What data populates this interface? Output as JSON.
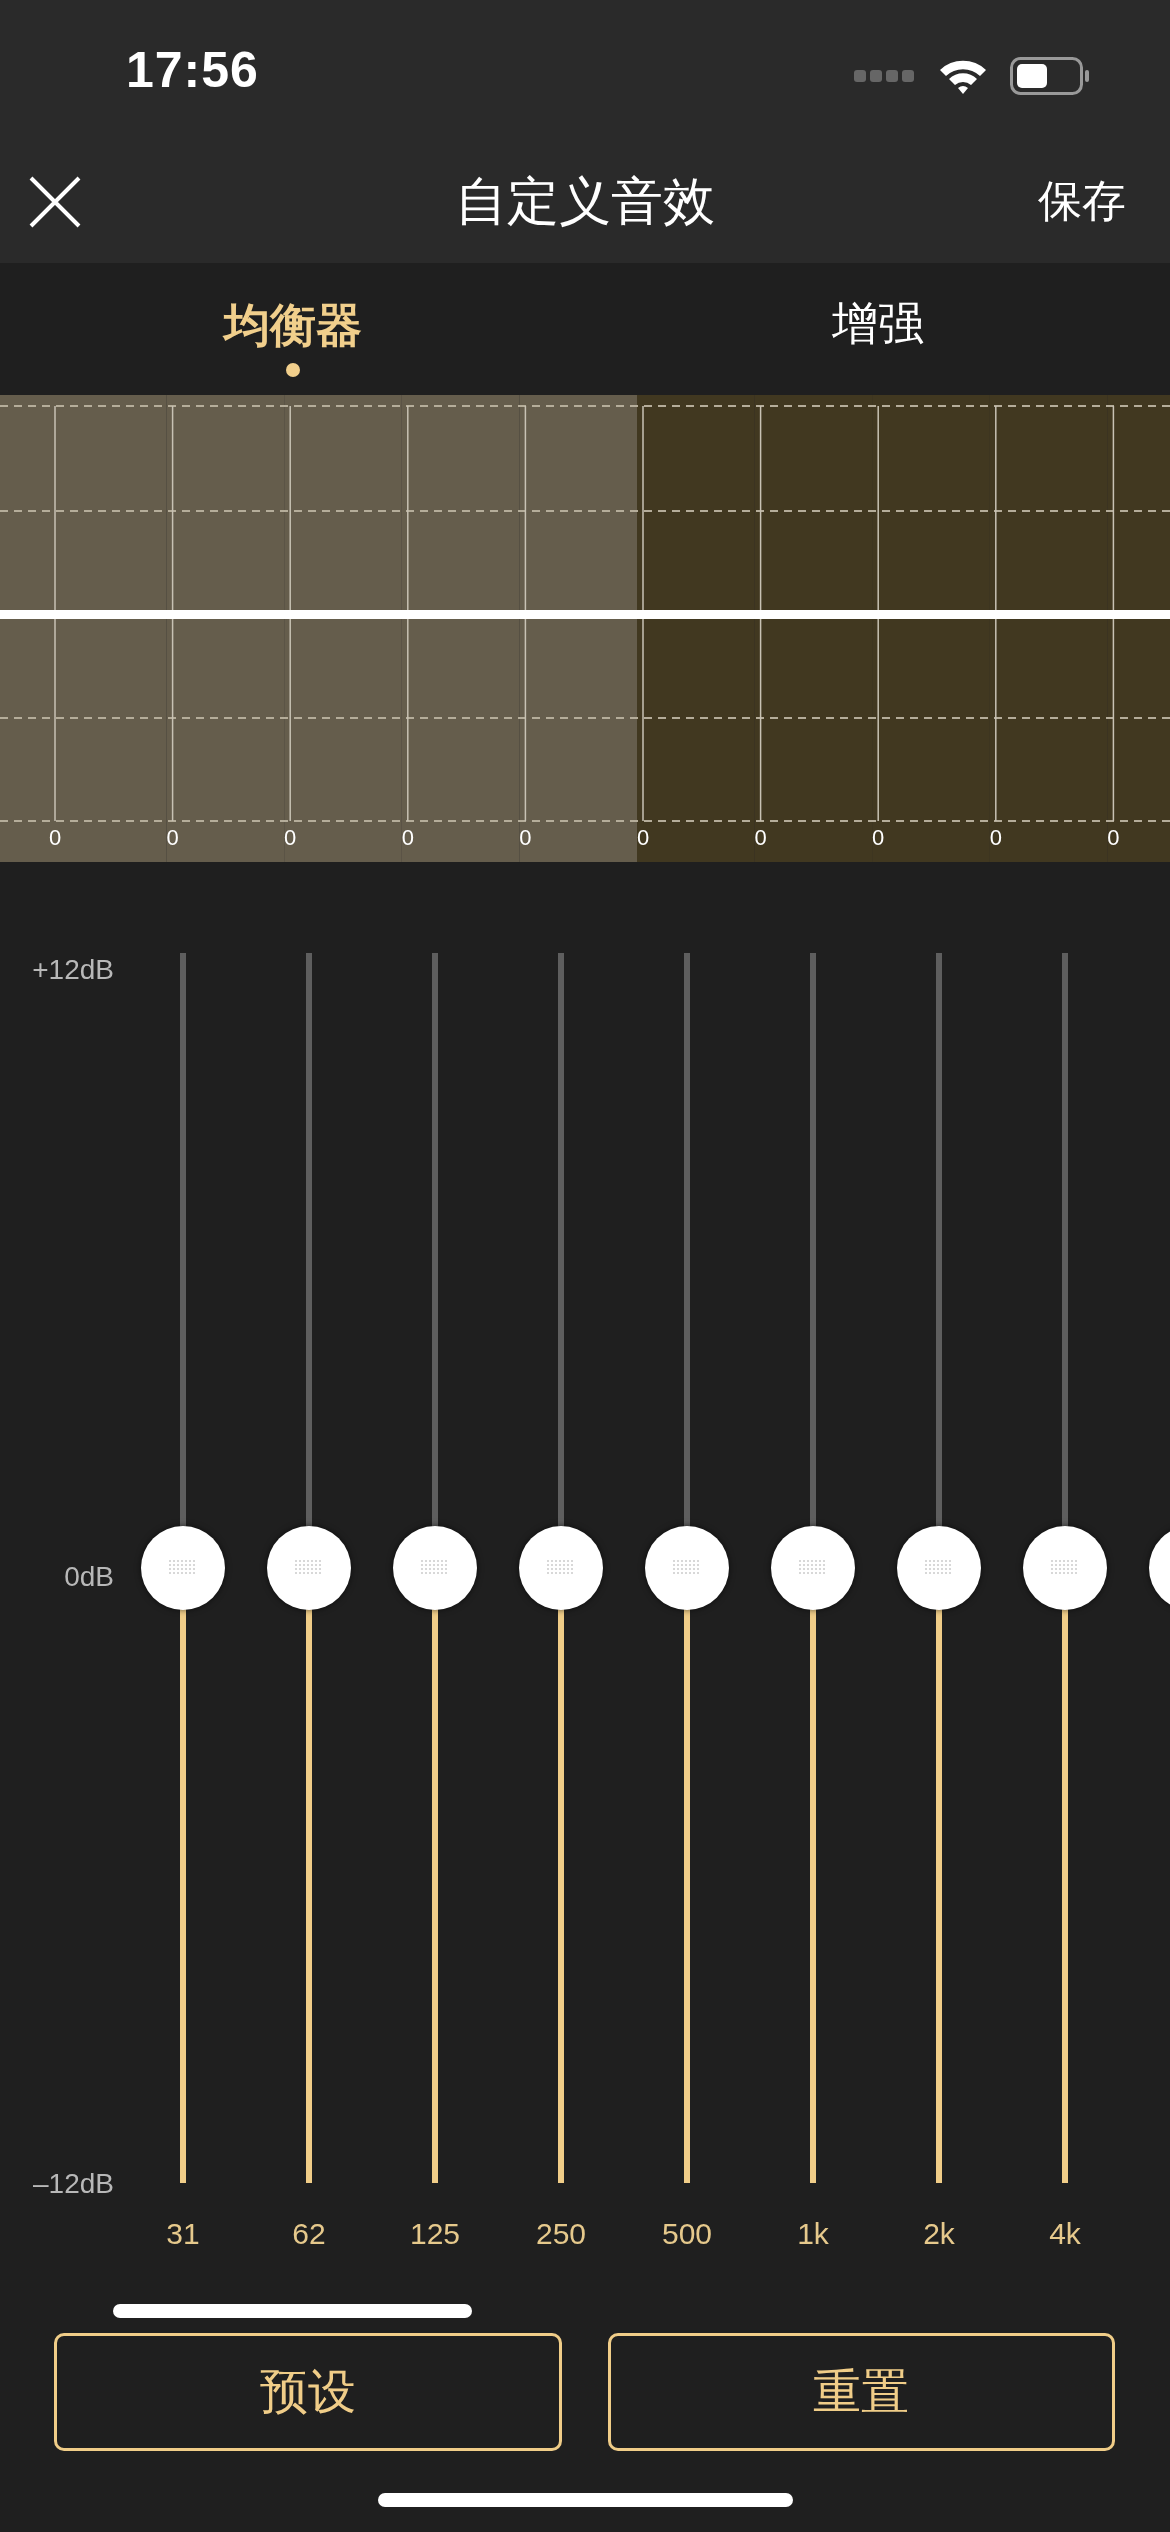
{
  "status_bar": {
    "time": "17:56"
  },
  "nav": {
    "title": "自定义音效",
    "action": "保存"
  },
  "tabs": [
    {
      "label": "均衡器",
      "selected": true
    },
    {
      "label": "增强",
      "selected": false
    }
  ],
  "graph": {
    "bands": [
      {
        "value": "0",
        "highlighted": true
      },
      {
        "value": "0",
        "highlighted": true
      },
      {
        "value": "0",
        "highlighted": true
      },
      {
        "value": "0",
        "highlighted": true
      },
      {
        "value": "0",
        "highlighted": true
      },
      {
        "value": "0",
        "highlighted": false
      },
      {
        "value": "0",
        "highlighted": false
      },
      {
        "value": "0",
        "highlighted": false
      },
      {
        "value": "0",
        "highlighted": false
      },
      {
        "value": "0",
        "highlighted": false
      }
    ]
  },
  "scale": {
    "top": "+12dB",
    "middle": "0dB",
    "bottom": "–12dB"
  },
  "sliders": [
    {
      "label": "31",
      "level": 0.5
    },
    {
      "label": "62",
      "level": 0.5
    },
    {
      "label": "125",
      "level": 0.5
    },
    {
      "label": "250",
      "level": 0.5
    },
    {
      "label": "500",
      "level": 0.5
    },
    {
      "label": "1k",
      "level": 0.5
    },
    {
      "label": "2k",
      "level": 0.5
    },
    {
      "label": "4k",
      "level": 0.5
    },
    {
      "level": 0.5
    }
  ],
  "buttons": [
    "预设",
    "重置"
  ]
}
